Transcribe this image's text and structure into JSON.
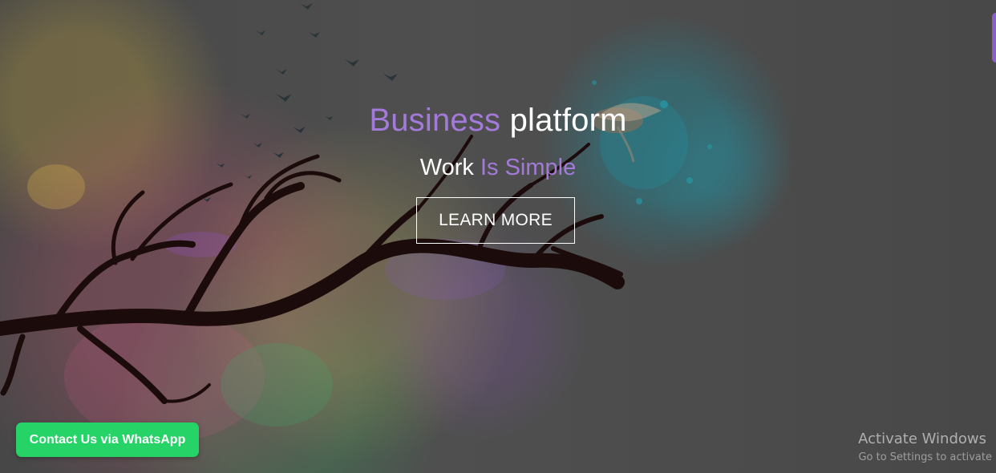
{
  "hero": {
    "headline_primary": "Business",
    "headline_secondary": "platform",
    "subheadline_primary": "Work",
    "subheadline_secondary": "Is Simple",
    "button_label": "LEARN MORE"
  },
  "floating": {
    "whatsapp_label": "Contact Us via WhatsApp"
  },
  "system_overlay": {
    "activate_title": "Activate Windows",
    "activate_subtitle": "Go to Settings to activate"
  },
  "colors": {
    "accent_purple": "#a37ad9",
    "whatsapp_green": "#25d366",
    "overlay_gray": "#4b4b4b"
  },
  "icons": {
    "hero_illustration": "tree-branch-with-birds-illustration"
  }
}
